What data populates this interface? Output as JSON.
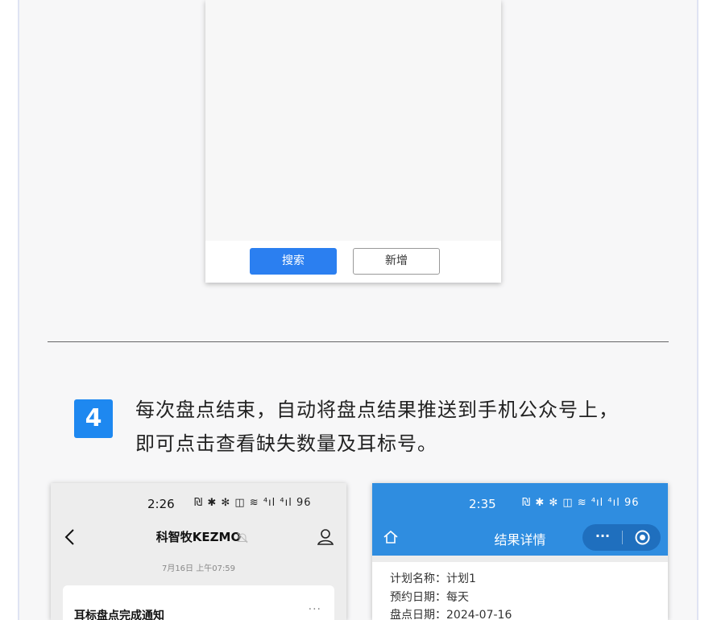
{
  "top_phone": {
    "search_label": "搜索",
    "add_label": "新增",
    "accent": "#2b7ff0"
  },
  "step": {
    "number": "4",
    "line1": "每次盘点结束，自动将盘点结果推送到手机公众号上，",
    "line2": "即可点击查看缺失数量及耳标号。",
    "badge_color": "#1e88f0"
  },
  "chat_phone": {
    "status_time": "2:26",
    "status_icons": "₪ ✱ ✻ ◫ ≋ ⁴ıl ⁴ıl 96",
    "title": "科智牧KEZMO",
    "date": "7月16日 上午07:59",
    "card_title": "耳标盘点完成通知",
    "card_more": "···",
    "icons": [
      "back-icon",
      "mute-icon",
      "person-icon"
    ]
  },
  "result_phone": {
    "status_time": "2:35",
    "status_icons": "₪ ✱ ✻ ◫ ≋ ⁴ıl ⁴ıl 96",
    "title": "结果详情",
    "capsule_more": "···",
    "header_color": "#2f8de0",
    "rows": [
      {
        "label": "计划名称：",
        "value": "计划1"
      },
      {
        "label": "预约日期：",
        "value": "每天"
      },
      {
        "label": "盘点日期：",
        "value": "2024-07-16"
      }
    ],
    "icons": [
      "home-icon",
      "more-icon",
      "target-icon"
    ]
  }
}
